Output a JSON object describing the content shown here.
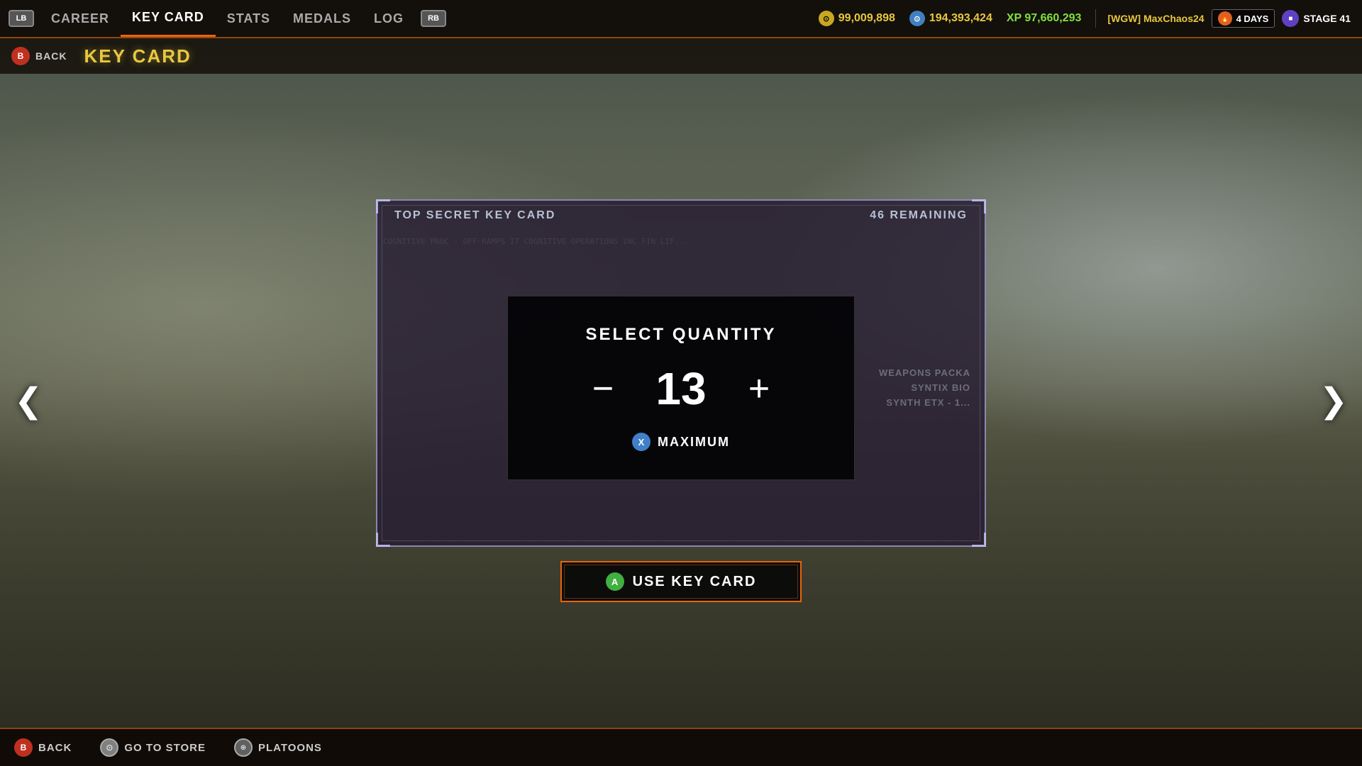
{
  "nav": {
    "lb": "LB",
    "rb": "RB",
    "items": [
      {
        "label": "CAREER",
        "active": false
      },
      {
        "label": "KEY CARD",
        "active": true
      },
      {
        "label": "STATS",
        "active": false
      },
      {
        "label": "MEDALS",
        "active": false
      },
      {
        "label": "LOG",
        "active": false
      }
    ]
  },
  "hud": {
    "currency1_icon": "⊙",
    "currency1_value": "99,009,898",
    "currency2_icon": "⊙",
    "currency2_value": "194,393,424",
    "xp_label": "XP",
    "xp_value": "97,660,293",
    "player_name": "[WGW] MaxChaos24",
    "days_icon": "🔥",
    "days_text": "4 DAYS",
    "stage_label": "STAGE 41"
  },
  "secondary": {
    "back_button": "B",
    "back_label": "BACK",
    "page_title": "KEY CARD"
  },
  "keycard": {
    "title": "TOP SECRET KEY CARD",
    "remaining": "46 REMAINING",
    "bg_text": "COGNITIVE PROC · OFF-RAMPS IT\nCOGNITIVE OPERATIONS INC FIN LIF...\n\n\n\n\n\n\n",
    "weapons_title": "WEAPONS PACKA",
    "weapons_sub": "SYNTIX BIO SYNTH ETX - 1..."
  },
  "quantity_dialog": {
    "title": "SELECT QUANTITY",
    "value": "13",
    "decrease_btn": "−",
    "increase_btn": "+",
    "x_button": "X",
    "maximum_label": "MAXIMUM"
  },
  "use_button": {
    "a_button": "A",
    "label": "USE KEY CARD"
  },
  "bottom": {
    "back_button": "B",
    "back_label": "BACK",
    "store_label": "GO TO STORE",
    "platoons_label": "PLATOONS"
  },
  "arrows": {
    "left": "❮",
    "right": "❯"
  }
}
